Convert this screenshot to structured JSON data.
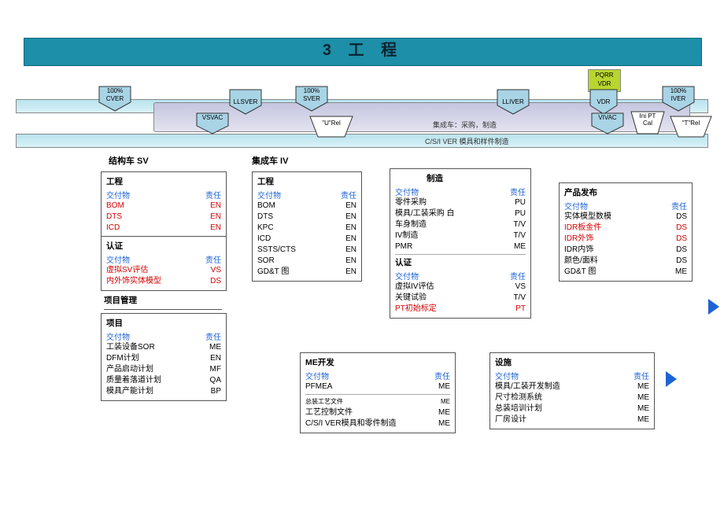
{
  "title": "3   工   程",
  "shields": {
    "cver": {
      "top": "100%",
      "bot": "CVER"
    },
    "llsver": {
      "top": "",
      "bot": "LLSVER"
    },
    "sver": {
      "top": "100%",
      "bot": "SVER"
    },
    "lliver": {
      "top": "",
      "bot": "LLIVER"
    },
    "vdr": {
      "top": "",
      "bot": "VDR"
    },
    "iver": {
      "top": "100%",
      "bot": "IVER"
    },
    "vsvac": {
      "top": "",
      "bot": "VSVAC"
    },
    "vivac": {
      "top": "",
      "bot": "VIVAC"
    }
  },
  "trapezoids": {
    "urel": "\"U\"Rel",
    "inipt": "Ini PT\nCal",
    "trel": "\"T\"Rel"
  },
  "greenbox": {
    "l1": "PQRR",
    "l2": "VDR"
  },
  "tracks": {
    "mid": "集成车：采购，制造",
    "bot": "C/S/I VER  模具和样件制造"
  },
  "sections": {
    "sv": "结构车  SV",
    "iv": "集成车  IV"
  },
  "hdr": {
    "k": "交付物",
    "v": "责任"
  },
  "cards": {
    "sv_eng": {
      "title": "工程",
      "rows": [
        {
          "k": "BOM",
          "v": "EN",
          "red": true
        },
        {
          "k": "DTS",
          "v": "EN",
          "red": true
        },
        {
          "k": "ICD",
          "v": "EN",
          "red": true
        }
      ]
    },
    "sv_cert": {
      "title": "认证",
      "rows": [
        {
          "k": "虚拟SV评估",
          "v": "VS",
          "red": true
        },
        {
          "k": "内外饰实体模型",
          "v": "DS",
          "red": true
        }
      ]
    },
    "sv_pm_title": "项目管理",
    "sv_pm": {
      "title": "项目",
      "rows": [
        {
          "k": "工装设备SOR",
          "v": "ME"
        },
        {
          "k": "DFM计划",
          "v": "EN"
        },
        {
          "k": "产品启动计划",
          "v": "MF"
        },
        {
          "k": "质量着落道计划",
          "v": "QA"
        },
        {
          "k": "模具产能计划",
          "v": "BP"
        }
      ]
    },
    "iv_eng": {
      "title": "工程",
      "rows": [
        {
          "k": "BOM",
          "v": "EN"
        },
        {
          "k": "DTS",
          "v": "EN"
        },
        {
          "k": "KPC",
          "v": "EN"
        },
        {
          "k": "ICD",
          "v": "EN"
        },
        {
          "k": "SSTS/CTS",
          "v": "EN"
        },
        {
          "k": "SOR",
          "v": "EN"
        },
        {
          "k": "GD&T 图",
          "v": "EN"
        }
      ]
    },
    "mfg": {
      "title": "制造",
      "rows": [
        {
          "k": "零件采购",
          "v": "PU"
        },
        {
          "k": "模具/工装采购  白",
          "v": "PU"
        },
        {
          "k": "车身制造",
          "v": "T/V"
        },
        {
          "k": "IV制造",
          "v": "T/V"
        },
        {
          "k": "PMR",
          "v": "ME"
        }
      ]
    },
    "cert2": {
      "title": "认证",
      "rows": [
        {
          "k": "虚拟IV评估",
          "v": "VS"
        },
        {
          "k": "关键试验",
          "v": "T/V"
        },
        {
          "k": "PT初始标定",
          "v": "PT",
          "red": true
        }
      ]
    },
    "release": {
      "title": "产品发布",
      "rows": [
        {
          "k": "实体模型数模",
          "v": "DS"
        },
        {
          "k": "IDR板金件",
          "v": "DS",
          "red": true
        },
        {
          "k": "IDR外饰",
          "v": "DS",
          "red": true
        },
        {
          "k": "IDR内饰",
          "v": "DS"
        },
        {
          "k": "颜色/面料",
          "v": "DS"
        },
        {
          "k": "GD&T 图",
          "v": "ME"
        }
      ]
    },
    "medev": {
      "title": "ME开发",
      "rows": [
        {
          "k": "PFMEA",
          "v": "ME"
        },
        {
          "k": "总装工艺文件",
          "v": "ME",
          "small": true
        },
        {
          "k": "工艺控制文件",
          "v": "ME"
        },
        {
          "k": "C/S/I VER模具和零件制造",
          "v": "ME"
        }
      ]
    },
    "facility": {
      "title": "设施",
      "rows": [
        {
          "k": "模具/工装开发制造",
          "v": "ME"
        },
        {
          "k": "尺寸检测系统",
          "v": "ME"
        },
        {
          "k": "总装培训计划",
          "v": "ME"
        },
        {
          "k": "厂房设计",
          "v": "ME"
        }
      ]
    }
  }
}
